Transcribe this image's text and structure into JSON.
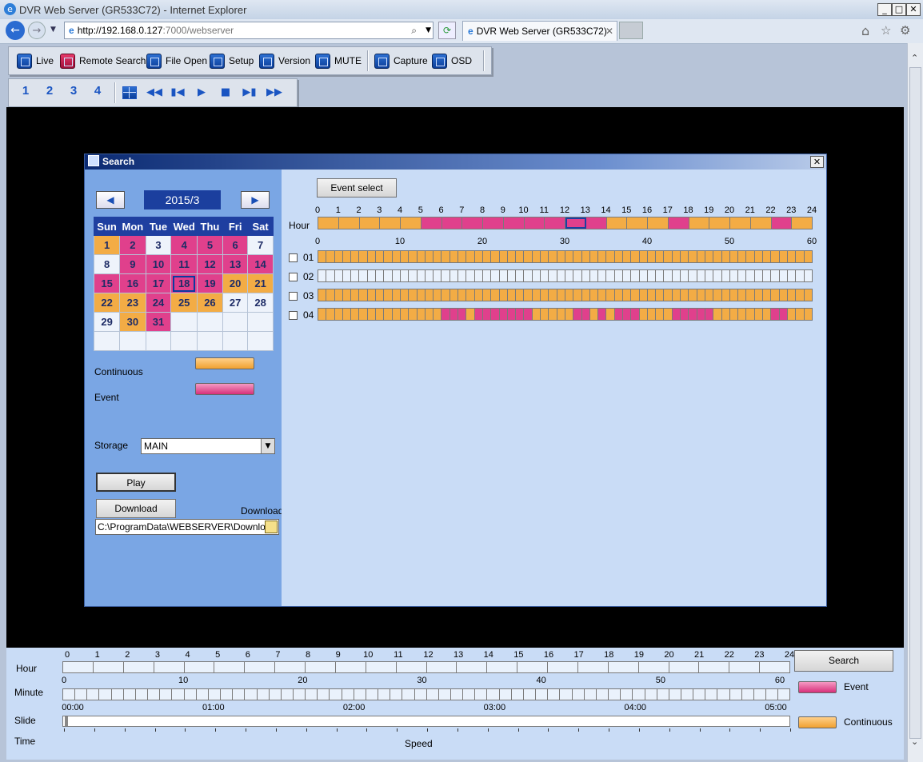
{
  "window": {
    "title": "DVR Web Server (GR533C72) - Internet Explorer"
  },
  "browser": {
    "url_host": "http://192.168.0.127",
    "url_rest": ":7000/webserver",
    "tab_title": "DVR Web Server (GR533C72)"
  },
  "toolbar1": [
    {
      "label": "Live",
      "icon": "live-icon"
    },
    {
      "label": "Remote Search",
      "icon": "remote-search-icon"
    },
    {
      "label": "File Open",
      "icon": "file-open-icon"
    },
    {
      "label": "Setup",
      "icon": "setup-icon"
    },
    {
      "label": "Version",
      "icon": "version-icon"
    },
    {
      "label": "MUTE",
      "icon": "mute-icon"
    },
    {
      "label": "Capture",
      "icon": "capture-icon"
    },
    {
      "label": "OSD",
      "icon": "osd-icon"
    }
  ],
  "toolbar2": {
    "channels": [
      "1",
      "2",
      "3",
      "4"
    ]
  },
  "dialog": {
    "title": "Search",
    "month": "2015/3",
    "weekdays": [
      "Sun",
      "Mon",
      "Tue",
      "Wed",
      "Thu",
      "Fri",
      "Sat"
    ],
    "calendar": [
      [
        {
          "d": "1",
          "t": "c"
        },
        {
          "d": "2",
          "t": "e"
        },
        {
          "d": "3",
          "t": ""
        },
        {
          "d": "4",
          "t": "e"
        },
        {
          "d": "5",
          "t": "e"
        },
        {
          "d": "6",
          "t": "e"
        },
        {
          "d": "7",
          "t": ""
        }
      ],
      [
        {
          "d": "8",
          "t": ""
        },
        {
          "d": "9",
          "t": "e"
        },
        {
          "d": "10",
          "t": "e"
        },
        {
          "d": "11",
          "t": "e"
        },
        {
          "d": "12",
          "t": "e"
        },
        {
          "d": "13",
          "t": "e"
        },
        {
          "d": "14",
          "t": "e"
        }
      ],
      [
        {
          "d": "15",
          "t": "e"
        },
        {
          "d": "16",
          "t": "e"
        },
        {
          "d": "17",
          "t": "e"
        },
        {
          "d": "18",
          "t": "e",
          "sel": true
        },
        {
          "d": "19",
          "t": "e"
        },
        {
          "d": "20",
          "t": "c"
        },
        {
          "d": "21",
          "t": "c"
        }
      ],
      [
        {
          "d": "22",
          "t": "c"
        },
        {
          "d": "23",
          "t": "c"
        },
        {
          "d": "24",
          "t": "e"
        },
        {
          "d": "25",
          "t": "c"
        },
        {
          "d": "26",
          "t": "c"
        },
        {
          "d": "27",
          "t": ""
        },
        {
          "d": "28",
          "t": ""
        }
      ],
      [
        {
          "d": "29",
          "t": ""
        },
        {
          "d": "30",
          "t": "c"
        },
        {
          "d": "31",
          "t": "e"
        },
        {
          "d": "",
          "t": ""
        },
        {
          "d": "",
          "t": ""
        },
        {
          "d": "",
          "t": ""
        },
        {
          "d": "",
          "t": ""
        }
      ],
      [
        {
          "d": "",
          "t": ""
        },
        {
          "d": "",
          "t": ""
        },
        {
          "d": "",
          "t": ""
        },
        {
          "d": "",
          "t": ""
        },
        {
          "d": "",
          "t": ""
        },
        {
          "d": "",
          "t": ""
        },
        {
          "d": "",
          "t": ""
        }
      ]
    ],
    "legend_continuous": "Continuous",
    "legend_event": "Event",
    "storage_label": "Storage",
    "storage_value": "MAIN",
    "play_label": "Play",
    "download_button": "Download",
    "download_label": "Download",
    "download_path": "C:\\ProgramData\\WEBSERVER\\Download",
    "event_select": "Event select",
    "hour_label": "Hour",
    "hour_ticks": [
      "0",
      "1",
      "2",
      "3",
      "4",
      "5",
      "6",
      "7",
      "8",
      "9",
      "10",
      "11",
      "12",
      "13",
      "14",
      "15",
      "16",
      "17",
      "18",
      "19",
      "20",
      "21",
      "22",
      "23",
      "24"
    ],
    "hour_bar": "cccccpppppppeecccpccccpc",
    "minute_ticks": [
      "0",
      "10",
      "20",
      "30",
      "40",
      "50",
      "60"
    ],
    "channels": [
      {
        "name": "01",
        "bar": "cccccccccccccccccccccccccccccccccccccccccccccccccccccccccccc"
      },
      {
        "name": "02",
        "bar": "wwwwwwwwwwwwwwwwwwwwwwwwwwwwwwwwwwwwwwwwwwwwwwwwwwwwwwwwwwww"
      },
      {
        "name": "03",
        "bar": "cccccccccccccccccccccccccccccccccccccccccccccccccccccccccccc"
      },
      {
        "name": "04",
        "bar": "cccccccccccccccpppcpppppppcccccppcpcpppccccpppppcccccccppccc"
      }
    ]
  },
  "bottom": {
    "hour_label": "Hour",
    "minute_label": "Minute",
    "slide_label": "Slide",
    "time_label": "Time",
    "speed_label": "Speed",
    "hour_ticks": [
      "0",
      "1",
      "2",
      "3",
      "4",
      "5",
      "6",
      "7",
      "8",
      "9",
      "10",
      "11",
      "12",
      "13",
      "14",
      "15",
      "16",
      "17",
      "18",
      "19",
      "20",
      "21",
      "22",
      "23",
      "24"
    ],
    "minute_ticks": [
      "0",
      "10",
      "20",
      "30",
      "40",
      "50",
      "60"
    ],
    "time_ticks": [
      "00:00",
      "01:00",
      "02:00",
      "03:00",
      "04:00",
      "05:00"
    ],
    "search_label": "Search",
    "legend_event": "Event",
    "legend_continuous": "Continuous"
  },
  "colors": {
    "event": "#e0408c",
    "continuous": "#f3ac45"
  }
}
